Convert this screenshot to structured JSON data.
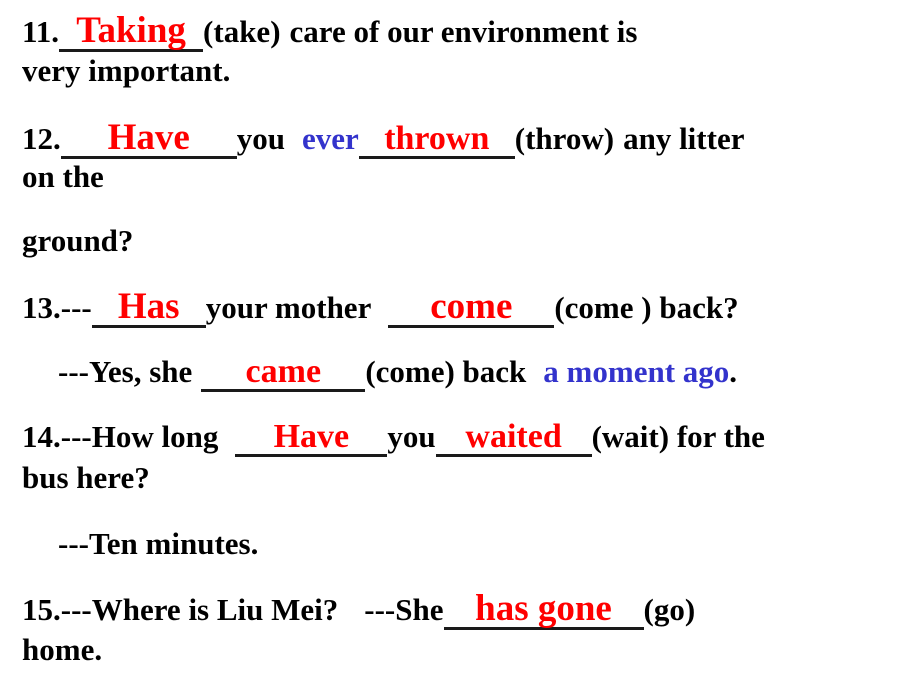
{
  "slide": {
    "background_color": "#ffffff",
    "text_color": "#000000",
    "answer_color": "#ff0000",
    "highlight_color": "#3333cc",
    "blank_rule_color": "#1a1a1a",
    "title": "Grammar fill-in-the-blank exercise items 11-15"
  },
  "exercises": [
    {
      "number": "11.",
      "answer": "Taking",
      "cue": "(take)",
      "line1_tail": "care   of  our   environment   is",
      "line2": "very  important."
    },
    {
      "number": "12.",
      "answer1": "Have",
      "mid": "you",
      "highlight": "ever",
      "answer2": "thrown",
      "cue": "(throw)",
      "line1_tail": "any  litter",
      "line2": "on  the",
      "line3": " ground?"
    },
    {
      "number": "13.---",
      "answer1": "Has",
      "mid1": "your   mother",
      "answer2": "come",
      "cue1": "(come )  back?",
      "reply_prefix": "---Yes,  she",
      "answer3": "came",
      "cue2": "(come)  back",
      "reply_highlight": "a  moment  ago",
      "reply_end": "."
    },
    {
      "number": "14.---",
      "prefix": "How  long",
      "answer1": "Have",
      "mid": "you",
      "answer2": "waited",
      "cue": "(wait)  for   the",
      "line2": "bus   here?",
      "reply": "---Ten  minutes."
    },
    {
      "number": "15.---",
      "prefix": "Where   is   Liu   Mei?",
      "reply_prefix": "---She",
      "answer": "has gone",
      "cue": "(go)",
      "line2": "home."
    }
  ]
}
